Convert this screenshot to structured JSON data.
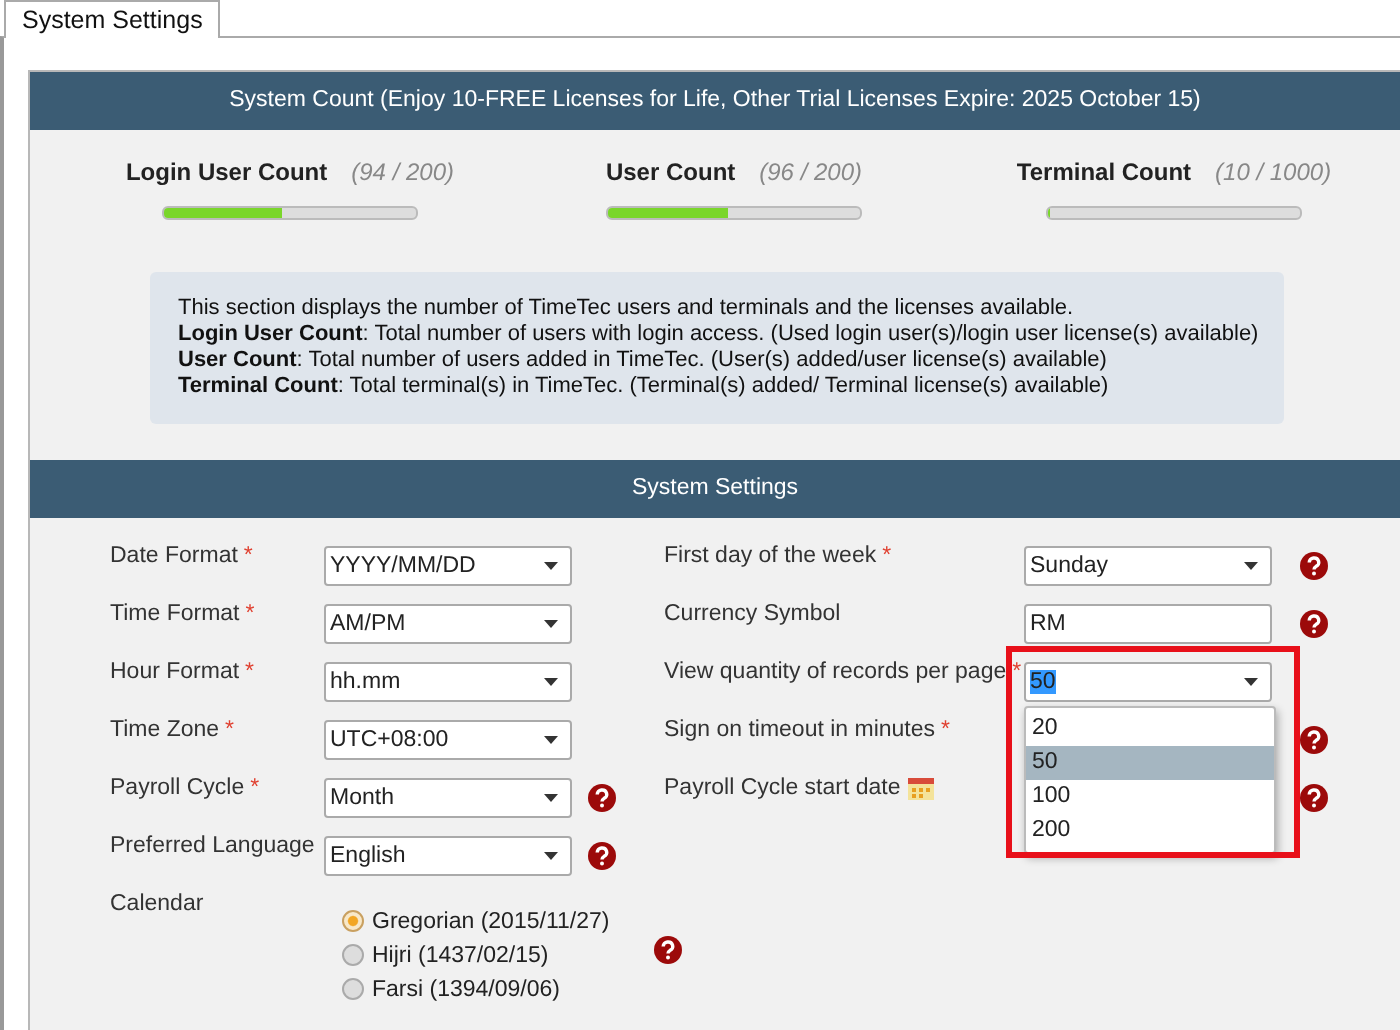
{
  "tabs": [
    {
      "label": "System Settings",
      "selected": true
    }
  ],
  "system_count": {
    "title": "System Count  (Enjoy 10-FREE Licenses for Life, Other Trial Licenses Expire: 2025 October 15)",
    "counters": [
      {
        "label": "Login User Count",
        "reading": "(94 / 200)",
        "level": 0.47
      },
      {
        "label": "User Count",
        "reading": "(96 / 200)",
        "level": 0.48
      },
      {
        "label": "Terminal Count",
        "reading": "(10 / 1000)",
        "level": 0.01
      }
    ],
    "info": [
      "This section displays the number of TimeTec users and terminals and the licenses available.",
      "**Login User Count**: Total number of users with login access. (Used login user(s)/login user license(s) available)",
      "**User Count**: Total number of users added in TimeTec. (User(s) added/user license(s) available)",
      "**Terminal Count**: Total terminal(s) in TimeTec. (Terminal(s) added/ Terminal license(s) available)"
    ]
  },
  "settings": {
    "title": "System Settings",
    "left": [
      {
        "label": "Date Format",
        "required_mark": "*",
        "kind": "select",
        "value": "YYYY/MM/DD",
        "help": false
      },
      {
        "label": "Time Format",
        "required_mark": "*",
        "kind": "select",
        "value": "AM/PM",
        "help": false
      },
      {
        "label": "Hour Format",
        "required_mark": "*",
        "kind": "select",
        "value": "hh.mm",
        "help": false
      },
      {
        "label": "Time Zone",
        "required_mark": "*",
        "kind": "select",
        "value": "UTC+08:00",
        "help": false
      },
      {
        "label": "Payroll Cycle",
        "required_mark": "*",
        "kind": "select",
        "value": "Month",
        "help": true
      },
      {
        "label": "Preferred Language",
        "kind": "select",
        "value": "English",
        "help": true
      }
    ],
    "right": [
      {
        "label": "First day of the week",
        "required_mark": "*",
        "kind": "select",
        "value": "Sunday",
        "help": true
      },
      {
        "label": "Currency Symbol",
        "kind": "text",
        "value": "RM",
        "help": true
      },
      {
        "label": "View quantity of records per page",
        "required_mark": "*",
        "kind": "dropdown",
        "value": "50",
        "help": false,
        "options": [
          {
            "label": "20",
            "selected": false
          },
          {
            "label": "50",
            "selected": true
          },
          {
            "label": "100",
            "selected": false
          },
          {
            "label": "200",
            "selected": false
          }
        ]
      },
      {
        "label": "Sign on timeout in minutes",
        "required_mark": "*",
        "kind": "hidden",
        "help": true
      },
      {
        "label": "Payroll Cycle start date",
        "kind": "date",
        "help": true
      }
    ],
    "calendar": {
      "label": "Calendar",
      "help": true,
      "options": [
        {
          "label": "Gregorian (2015/11/27)",
          "selected": true
        },
        {
          "label": "Hijri (1437/02/15)",
          "selected": false
        },
        {
          "label": "Farsi (1394/09/06)",
          "selected": false
        }
      ]
    }
  }
}
